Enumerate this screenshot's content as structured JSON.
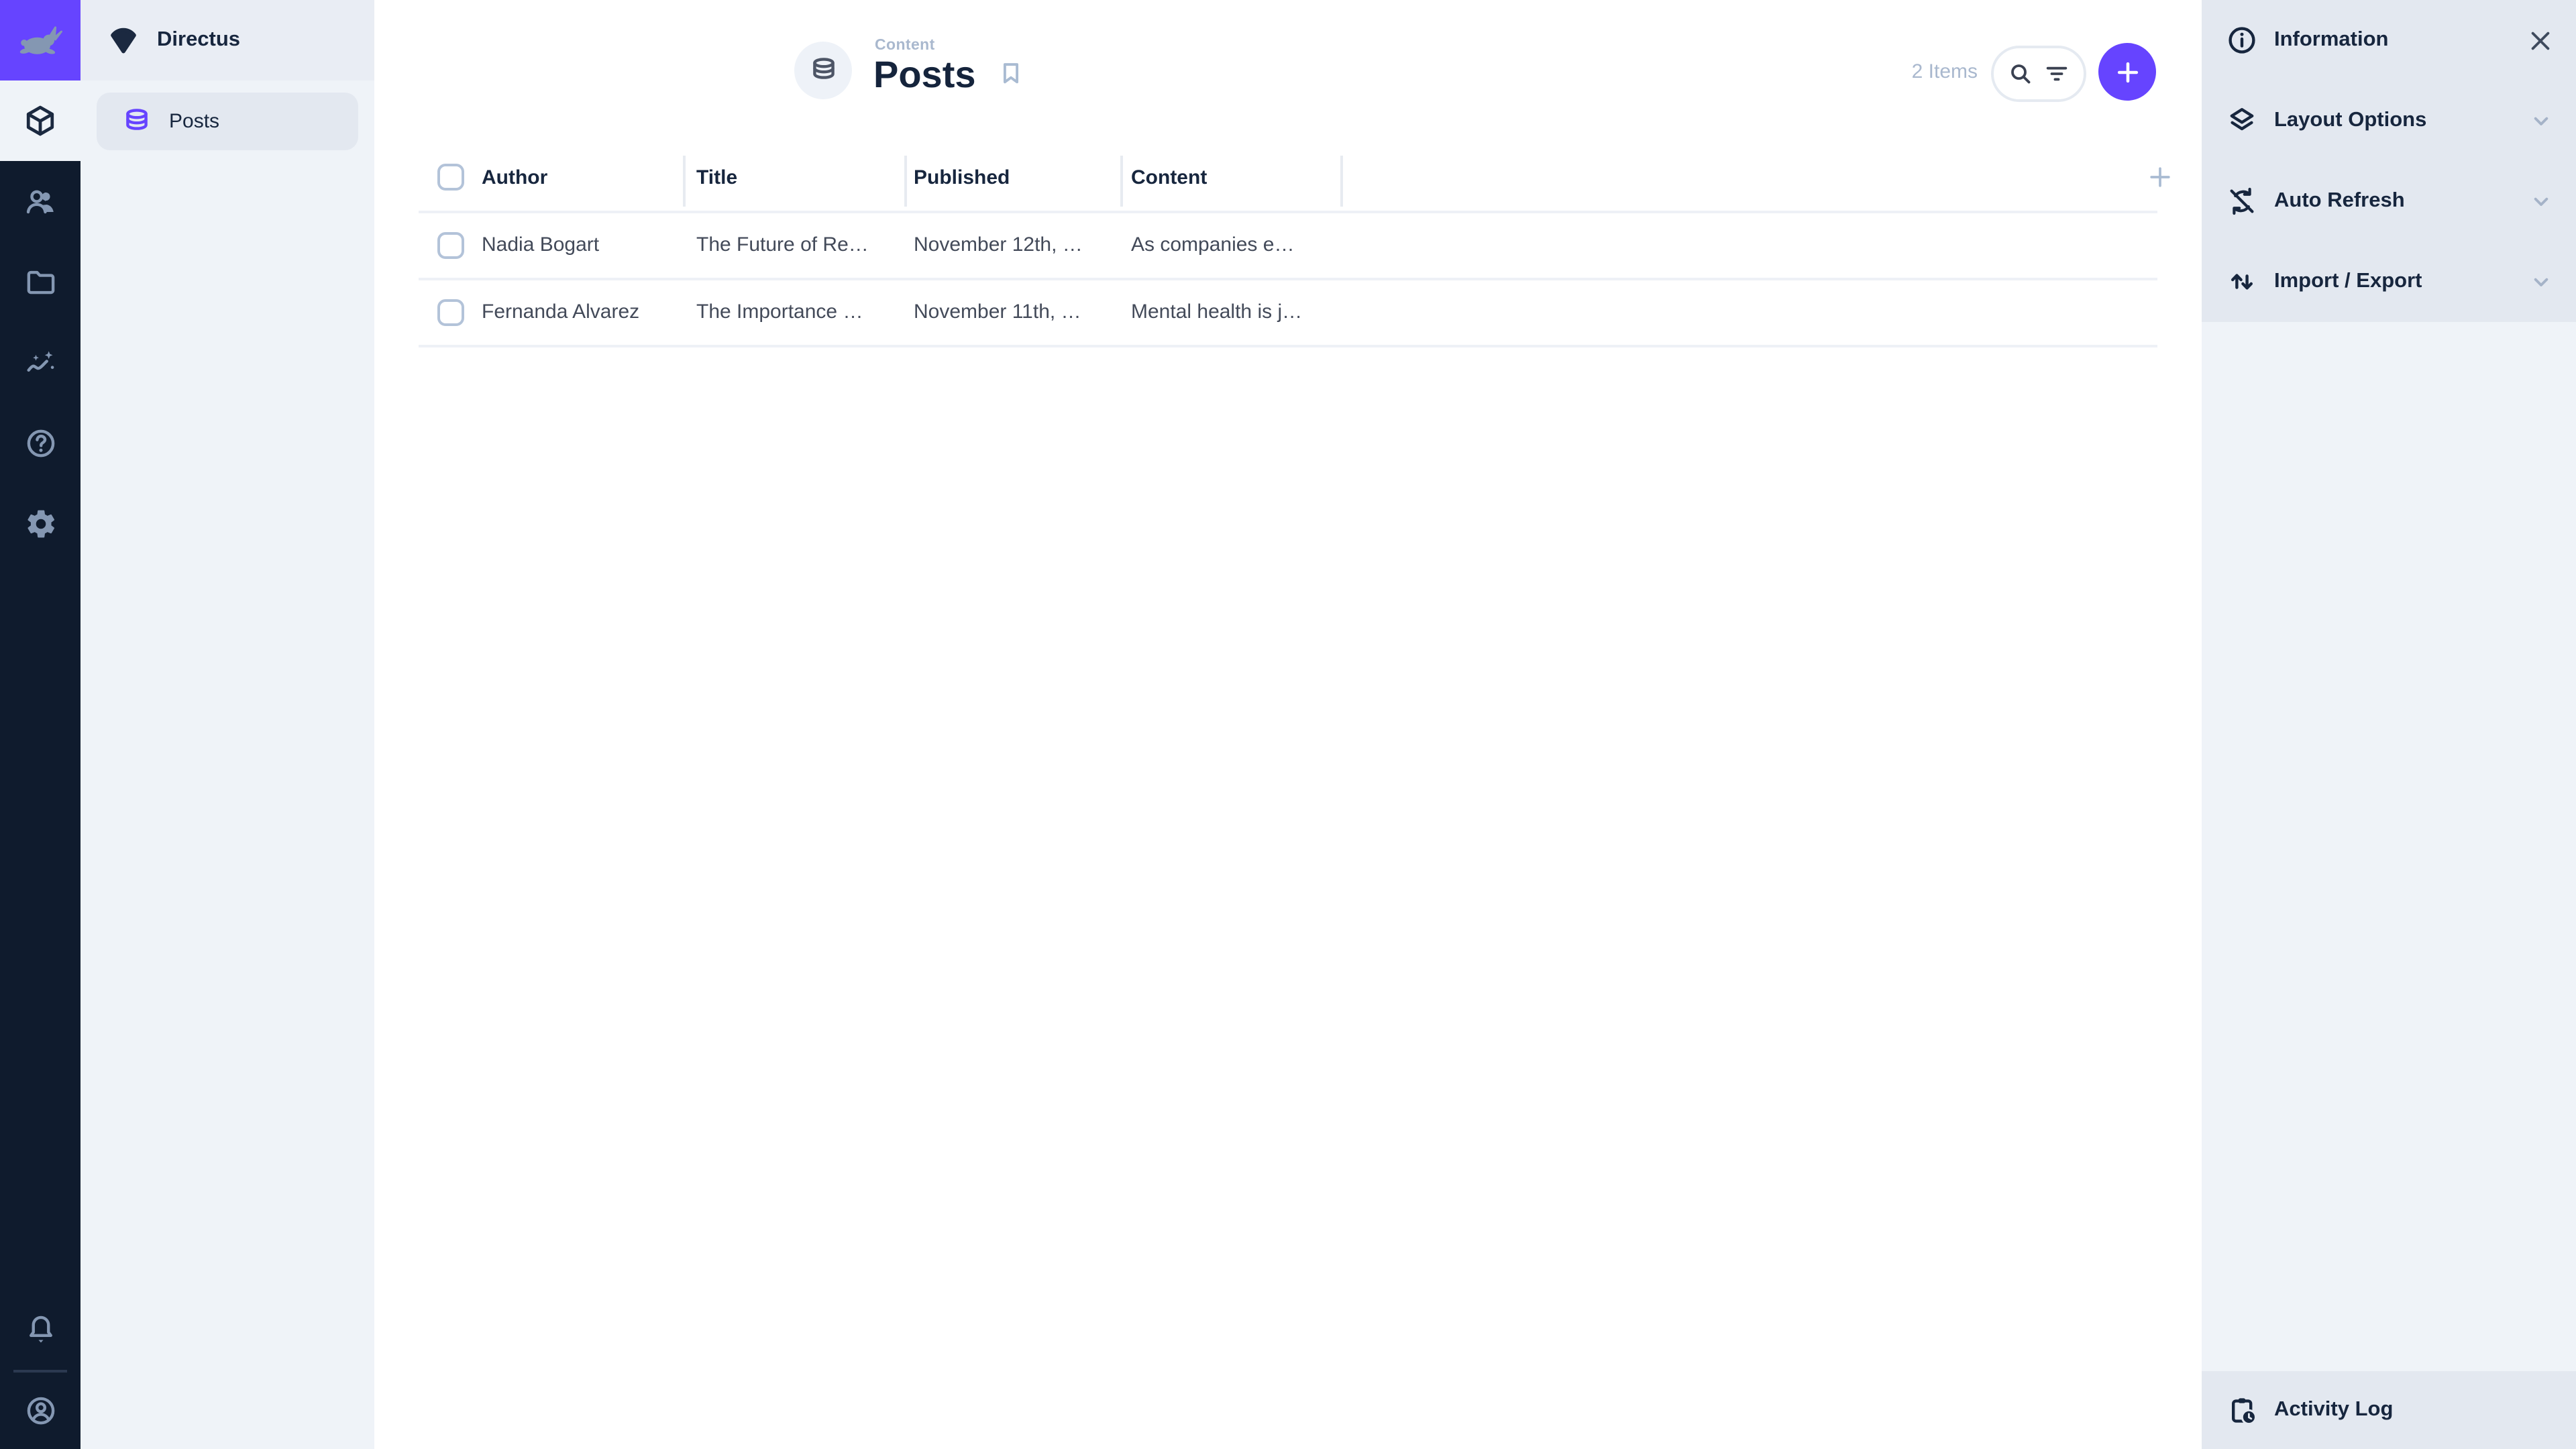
{
  "nav": {
    "project_name": "Directus",
    "project_logo_icon": "fan-logo-icon",
    "items": [
      {
        "label": "Posts",
        "icon": "database-icon",
        "active": true
      }
    ]
  },
  "module_bar": {
    "logo_icon": "rabbit-logo-icon",
    "items": [
      {
        "name": "content",
        "icon": "box-icon",
        "active": true
      },
      {
        "name": "user-directory",
        "icon": "people-icon",
        "active": false
      },
      {
        "name": "file-library",
        "icon": "folder-icon",
        "active": false
      },
      {
        "name": "insights",
        "icon": "insights-icon",
        "active": false
      },
      {
        "name": "help",
        "icon": "help-icon",
        "active": false
      },
      {
        "name": "settings",
        "icon": "gear-icon",
        "active": false
      }
    ],
    "bottom": [
      {
        "name": "notifications",
        "icon": "bell-icon"
      },
      {
        "name": "account",
        "icon": "avatar-icon"
      }
    ]
  },
  "header": {
    "breadcrumb": "Content",
    "title": "Posts",
    "collection_icon": "database-icon",
    "bookmark_icon": "bookmark-icon",
    "item_count": "2 Items"
  },
  "toolbar": {
    "search_icon": "search-icon",
    "filter_icon": "filter-icon",
    "add_icon": "plus-icon"
  },
  "table": {
    "columns": [
      "Author",
      "Title",
      "Published",
      "Content"
    ],
    "add_column_icon": "plus-icon",
    "rows": [
      {
        "author": "Nadia Bogart",
        "title": "The Future of Re…",
        "published": "November 12th, …",
        "content": "As companies e…"
      },
      {
        "author": "Fernanda Alvarez",
        "title": "The Importance …",
        "published": "November 11th, …",
        "content": "Mental health is j…"
      }
    ]
  },
  "sidebar": {
    "sections": [
      {
        "label": "Information",
        "icon": "info-icon",
        "control": "close-icon"
      },
      {
        "label": "Layout Options",
        "icon": "layers-icon",
        "control": "chevron-down-icon"
      },
      {
        "label": "Auto Refresh",
        "icon": "sync-disabled-icon",
        "control": "chevron-down-icon"
      },
      {
        "label": "Import / Export",
        "icon": "swap-vertical-icon",
        "control": "chevron-down-icon"
      }
    ],
    "footer": {
      "label": "Activity Log",
      "icon": "clipboard-clock-icon"
    }
  },
  "colors": {
    "accent": "#6644ff",
    "module_bar_bg": "#0f1b2d",
    "module_icon": "#8497b2",
    "surface": "#eff3f8",
    "surface_dark": "#e3e8f0",
    "nav_header": "#e9edf4",
    "text_dark": "#17263e",
    "text_body": "#434a59",
    "text_muted": "#a9b8ce",
    "separator": "#eef1f6",
    "pill_border": "#e5eaf1"
  }
}
